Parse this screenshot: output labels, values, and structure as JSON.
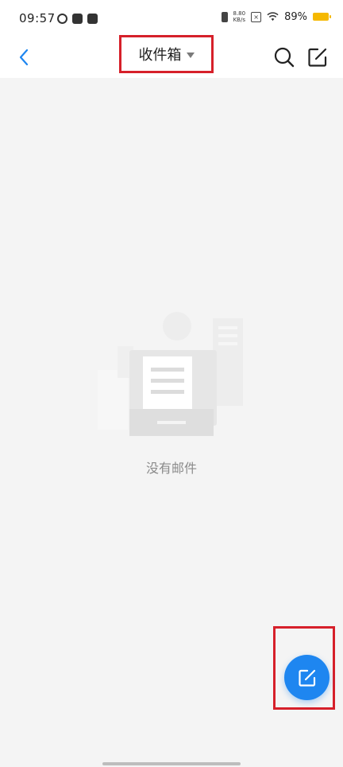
{
  "status_bar": {
    "time": "09:57",
    "net_speed_value": "8.80",
    "net_speed_unit": "KB/s",
    "battery_percent": "89%"
  },
  "header": {
    "title": "收件箱"
  },
  "main": {
    "empty_text": "没有邮件"
  },
  "icons": {
    "back": "chevron-left-icon",
    "dropdown": "caret-down-icon",
    "search": "search-icon",
    "compose": "compose-icon",
    "fab_compose": "compose-icon"
  },
  "colors": {
    "accent": "#1e86f0",
    "background": "#f4f4f4",
    "highlight_frame": "#d6202a",
    "battery": "#f5b800"
  }
}
